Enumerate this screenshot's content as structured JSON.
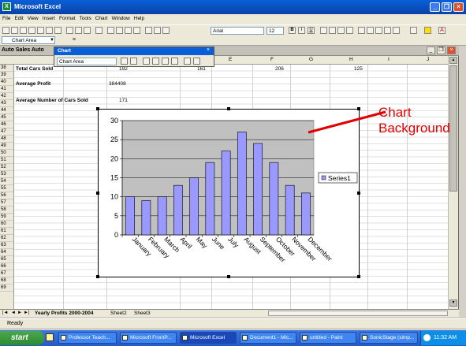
{
  "window": {
    "title": "Microsoft Excel"
  },
  "menu": [
    "File",
    "Edit",
    "View",
    "Insert",
    "Format",
    "Tools",
    "Chart",
    "Window",
    "Help"
  ],
  "toolbar": {
    "font": "Arial",
    "size": "12"
  },
  "namebox": "Chart Area",
  "workbook": {
    "title": "Auto Sales Auto"
  },
  "chart_toolbar": {
    "title": "Chart",
    "selected": "Chart Area"
  },
  "columns": [
    "E",
    "F",
    "G",
    "H",
    "I",
    "J"
  ],
  "rows": [
    "38",
    "39",
    "40",
    "41",
    "42",
    "43",
    "44",
    "45",
    "46",
    "47",
    "48",
    "49",
    "50",
    "51",
    "52",
    "53",
    "54",
    "55",
    "56",
    "57",
    "58",
    "59",
    "60",
    "61",
    "62",
    "63",
    "64",
    "65",
    "66",
    "67",
    "68",
    "69"
  ],
  "cells": {
    "total_label": "Total Cars Sold",
    "total_b": "192",
    "total_d": "161",
    "total_f": "206",
    "total_h": "125",
    "profit_label": "Average Profit",
    "profit_b": "384408",
    "avg_label": "Average Number of Cars Sold",
    "avg_b": "171"
  },
  "chart_data": {
    "type": "bar",
    "categories": [
      "January",
      "February",
      "March",
      "April",
      "May",
      "June",
      "July",
      "August",
      "September",
      "October",
      "November",
      "December"
    ],
    "series": [
      {
        "name": "Series1",
        "values": [
          10,
          9,
          10,
          13,
          15,
          19,
          22,
          27,
          24,
          19,
          13,
          11
        ]
      }
    ],
    "ylim": [
      0,
      30
    ],
    "yticks": [
      0,
      5,
      10,
      15,
      20,
      25,
      30
    ],
    "grid": true,
    "legend": "right",
    "colors": {
      "bar": "#9999ff",
      "plot_bg": "#c0c0c0"
    }
  },
  "annotation": {
    "line1": "Chart",
    "line2": "Background"
  },
  "sheets": [
    "Yearly Profits 2000-2004",
    "Sheet2",
    "Sheet3"
  ],
  "status": "Ready",
  "taskbar": {
    "start": "start",
    "items": [
      "Professor Teach...",
      "Microsoft FrontP...",
      "Microsoft Excel",
      "Document1 - Mic...",
      "untitled - Paint",
      "SonicStage (simp..."
    ],
    "clock": "11:32 AM"
  }
}
